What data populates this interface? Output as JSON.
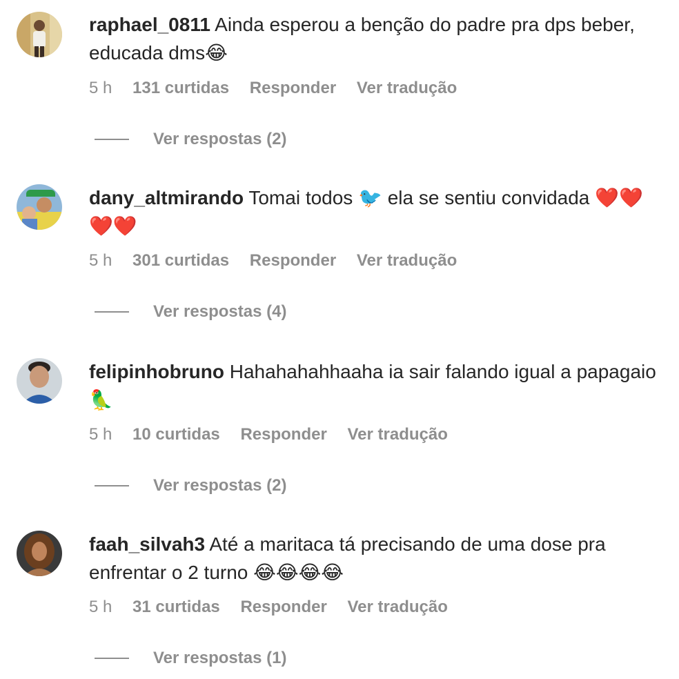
{
  "comments": [
    {
      "username": "raphael_0811",
      "text": "Ainda esperou a benção do padre pra dps beber, educada dms😂",
      "time": "5 h",
      "likes": "131 curtidas",
      "reply_label": "Responder",
      "translate_label": "Ver tradução",
      "replies_label": "Ver respostas (2)"
    },
    {
      "username": "dany_altmirando",
      "text": "Tomai todos 🐦 ela se sentiu convidada ❤️❤️❤️❤️",
      "time": "5 h",
      "likes": "301 curtidas",
      "reply_label": "Responder",
      "translate_label": "Ver tradução",
      "replies_label": "Ver respostas (4)"
    },
    {
      "username": "felipinhobruno",
      "text": "Hahahahahhaaha ia sair falando igual a papagaio 🦜",
      "time": "5 h",
      "likes": "10 curtidas",
      "reply_label": "Responder",
      "translate_label": "Ver tradução",
      "replies_label": "Ver respostas (2)"
    },
    {
      "username": "faah_silvah3",
      "text": "Até a maritaca tá precisando de uma dose pra enfrentar o 2 turno 😂😂😂😂",
      "time": "5 h",
      "likes": "31 curtidas",
      "reply_label": "Responder",
      "translate_label": "Ver tradução",
      "replies_label": "Ver respostas (1)"
    }
  ],
  "colors": {
    "text": "#262626",
    "secondary": "#8e8e8e",
    "background": "#ffffff"
  }
}
